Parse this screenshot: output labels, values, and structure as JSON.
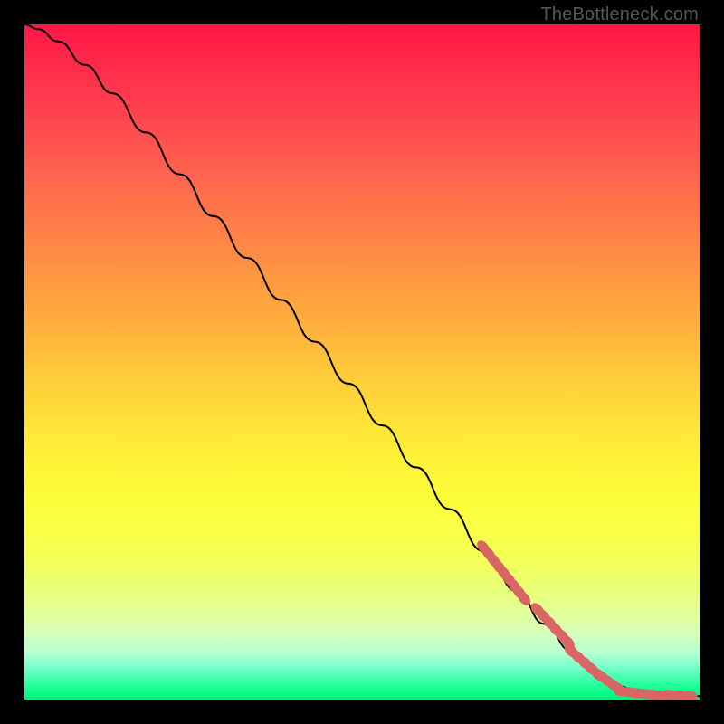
{
  "attribution": "TheBottleneck.com",
  "colors": {
    "gradient_top": "#ff1744",
    "gradient_mid": "#ffd239",
    "gradient_bottom": "#00f07e",
    "curve": "#000000",
    "dots": "#d96565",
    "page_bg": "#000000"
  },
  "chart_data": {
    "type": "line",
    "title": "",
    "xlabel": "",
    "ylabel": "",
    "xlim": [
      0,
      1
    ],
    "ylim": [
      0,
      1
    ],
    "series": [
      {
        "name": "bottleneck-curve",
        "x": [
          0.0,
          0.02,
          0.05,
          0.09,
          0.13,
          0.18,
          0.23,
          0.28,
          0.33,
          0.38,
          0.43,
          0.48,
          0.53,
          0.58,
          0.63,
          0.68,
          0.73,
          0.77,
          0.81,
          0.85,
          0.88,
          0.91,
          0.94,
          0.97,
          1.0
        ],
        "y": [
          1.0,
          0.993,
          0.975,
          0.94,
          0.898,
          0.84,
          0.778,
          0.716,
          0.654,
          0.592,
          0.53,
          0.468,
          0.406,
          0.344,
          0.282,
          0.22,
          0.16,
          0.112,
          0.072,
          0.04,
          0.02,
          0.01,
          0.006,
          0.005,
          0.005
        ]
      }
    ],
    "scatter_clusters": [
      {
        "name": "cluster-a",
        "x_range": [
          0.68,
          0.74
        ],
        "y_range": [
          0.15,
          0.225
        ],
        "count": 9
      },
      {
        "name": "cluster-b",
        "x_range": [
          0.76,
          0.805
        ],
        "y_range": [
          0.085,
          0.133
        ],
        "count": 6
      },
      {
        "name": "cluster-c",
        "x_range": [
          0.81,
          0.85
        ],
        "y_range": [
          0.037,
          0.072
        ],
        "count": 5
      },
      {
        "name": "cluster-d",
        "x_range": [
          0.855,
          0.88
        ],
        "y_range": [
          0.016,
          0.034
        ],
        "count": 4
      },
      {
        "name": "cluster-e",
        "x_range": [
          0.885,
          0.94
        ],
        "y_range": [
          0.006,
          0.012
        ],
        "count": 6
      },
      {
        "name": "cluster-f",
        "x_range": [
          0.955,
          0.985
        ],
        "y_range": [
          0.005,
          0.007
        ],
        "count": 3
      }
    ]
  }
}
